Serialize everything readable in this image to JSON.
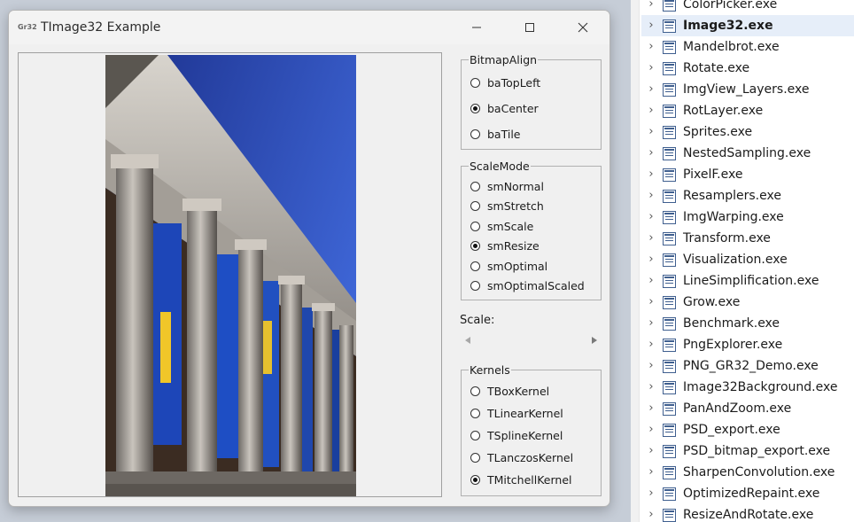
{
  "window": {
    "title": "TImage32 Example",
    "app_icon_label": "Gr32"
  },
  "bitmap_align": {
    "title": "BitmapAlign",
    "options": [
      {
        "label": "baTopLeft",
        "checked": false
      },
      {
        "label": "baCenter",
        "checked": true
      },
      {
        "label": "baTile",
        "checked": false
      }
    ]
  },
  "scale_mode": {
    "title": "ScaleMode",
    "options": [
      {
        "label": "smNormal",
        "checked": false
      },
      {
        "label": "smStretch",
        "checked": false
      },
      {
        "label": "smScale",
        "checked": false
      },
      {
        "label": "smResize",
        "checked": true
      },
      {
        "label": "smOptimal",
        "checked": false
      },
      {
        "label": "smOptimalScaled",
        "checked": false
      }
    ]
  },
  "scale": {
    "label": "Scale:"
  },
  "kernels": {
    "title": "Kernels",
    "options": [
      {
        "label": "TBoxKernel",
        "checked": false
      },
      {
        "label": "TLinearKernel",
        "checked": false
      },
      {
        "label": "TSplineKernel",
        "checked": false
      },
      {
        "label": "TLanczosKernel",
        "checked": false
      },
      {
        "label": "TMitchellKernel",
        "checked": true
      }
    ]
  },
  "explorer": {
    "files": [
      {
        "name": "ColorPicker.exe",
        "selected": false
      },
      {
        "name": "Image32.exe",
        "selected": true
      },
      {
        "name": "Mandelbrot.exe",
        "selected": false
      },
      {
        "name": "Rotate.exe",
        "selected": false
      },
      {
        "name": "ImgView_Layers.exe",
        "selected": false
      },
      {
        "name": "RotLayer.exe",
        "selected": false
      },
      {
        "name": "Sprites.exe",
        "selected": false
      },
      {
        "name": "NestedSampling.exe",
        "selected": false
      },
      {
        "name": "PixelF.exe",
        "selected": false
      },
      {
        "name": "Resamplers.exe",
        "selected": false
      },
      {
        "name": "ImgWarping.exe",
        "selected": false
      },
      {
        "name": "Transform.exe",
        "selected": false
      },
      {
        "name": "Visualization.exe",
        "selected": false
      },
      {
        "name": "LineSimplification.exe",
        "selected": false
      },
      {
        "name": "Grow.exe",
        "selected": false
      },
      {
        "name": "Benchmark.exe",
        "selected": false
      },
      {
        "name": "PngExplorer.exe",
        "selected": false
      },
      {
        "name": "PNG_GR32_Demo.exe",
        "selected": false
      },
      {
        "name": "Image32Background.exe",
        "selected": false
      },
      {
        "name": "PanAndZoom.exe",
        "selected": false
      },
      {
        "name": "PSD_export.exe",
        "selected": false
      },
      {
        "name": "PSD_bitmap_export.exe",
        "selected": false
      },
      {
        "name": "SharpenConvolution.exe",
        "selected": false
      },
      {
        "name": "OptimizedRepaint.exe",
        "selected": false
      },
      {
        "name": "ResizeAndRotate.exe",
        "selected": false
      }
    ]
  }
}
